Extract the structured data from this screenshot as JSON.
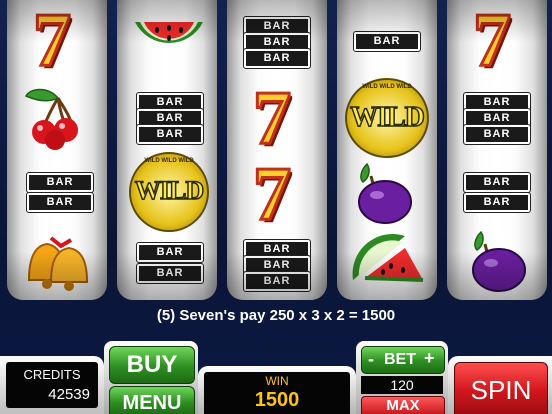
{
  "reels": [
    {
      "top": "seven",
      "middle": "cherries",
      "lower_mid": "bar-2",
      "bottom": "bells"
    },
    {
      "top": "watermelon",
      "middle": "bar-3",
      "lower_mid": "wild",
      "bottom": "bar-2"
    },
    {
      "top": "bar-3",
      "middle": "seven",
      "lower_mid": "seven",
      "bottom": "bar-3"
    },
    {
      "top": "bar-1",
      "middle": "wild",
      "lower_mid": "plum",
      "bottom": "watermelon"
    },
    {
      "top": "seven",
      "middle": "bar-3",
      "lower_mid": "bar-2",
      "bottom": "plum"
    }
  ],
  "symbol_text": {
    "bar": "BAR",
    "seven": "7",
    "wild_big": "WILD",
    "wild_ring": "WILD WILD WILD"
  },
  "pay_message": "(5) Seven's pay 250 x 3 x 2 = 1500",
  "credits": {
    "label": "CREDITS",
    "value": "42539"
  },
  "buttons": {
    "buy": "BUY",
    "menu": "MENU",
    "spin": "SPIN",
    "max": "MAX",
    "bet_minus": "-",
    "bet_plus": "+",
    "bet_label": "BET"
  },
  "win": {
    "label": "WIN",
    "value": "1500"
  },
  "bet": {
    "value": "120"
  },
  "colors": {
    "gold": "#ffcf2a",
    "red": "#c0301b",
    "green": "#2e8f22",
    "navy": "#0b1740"
  }
}
